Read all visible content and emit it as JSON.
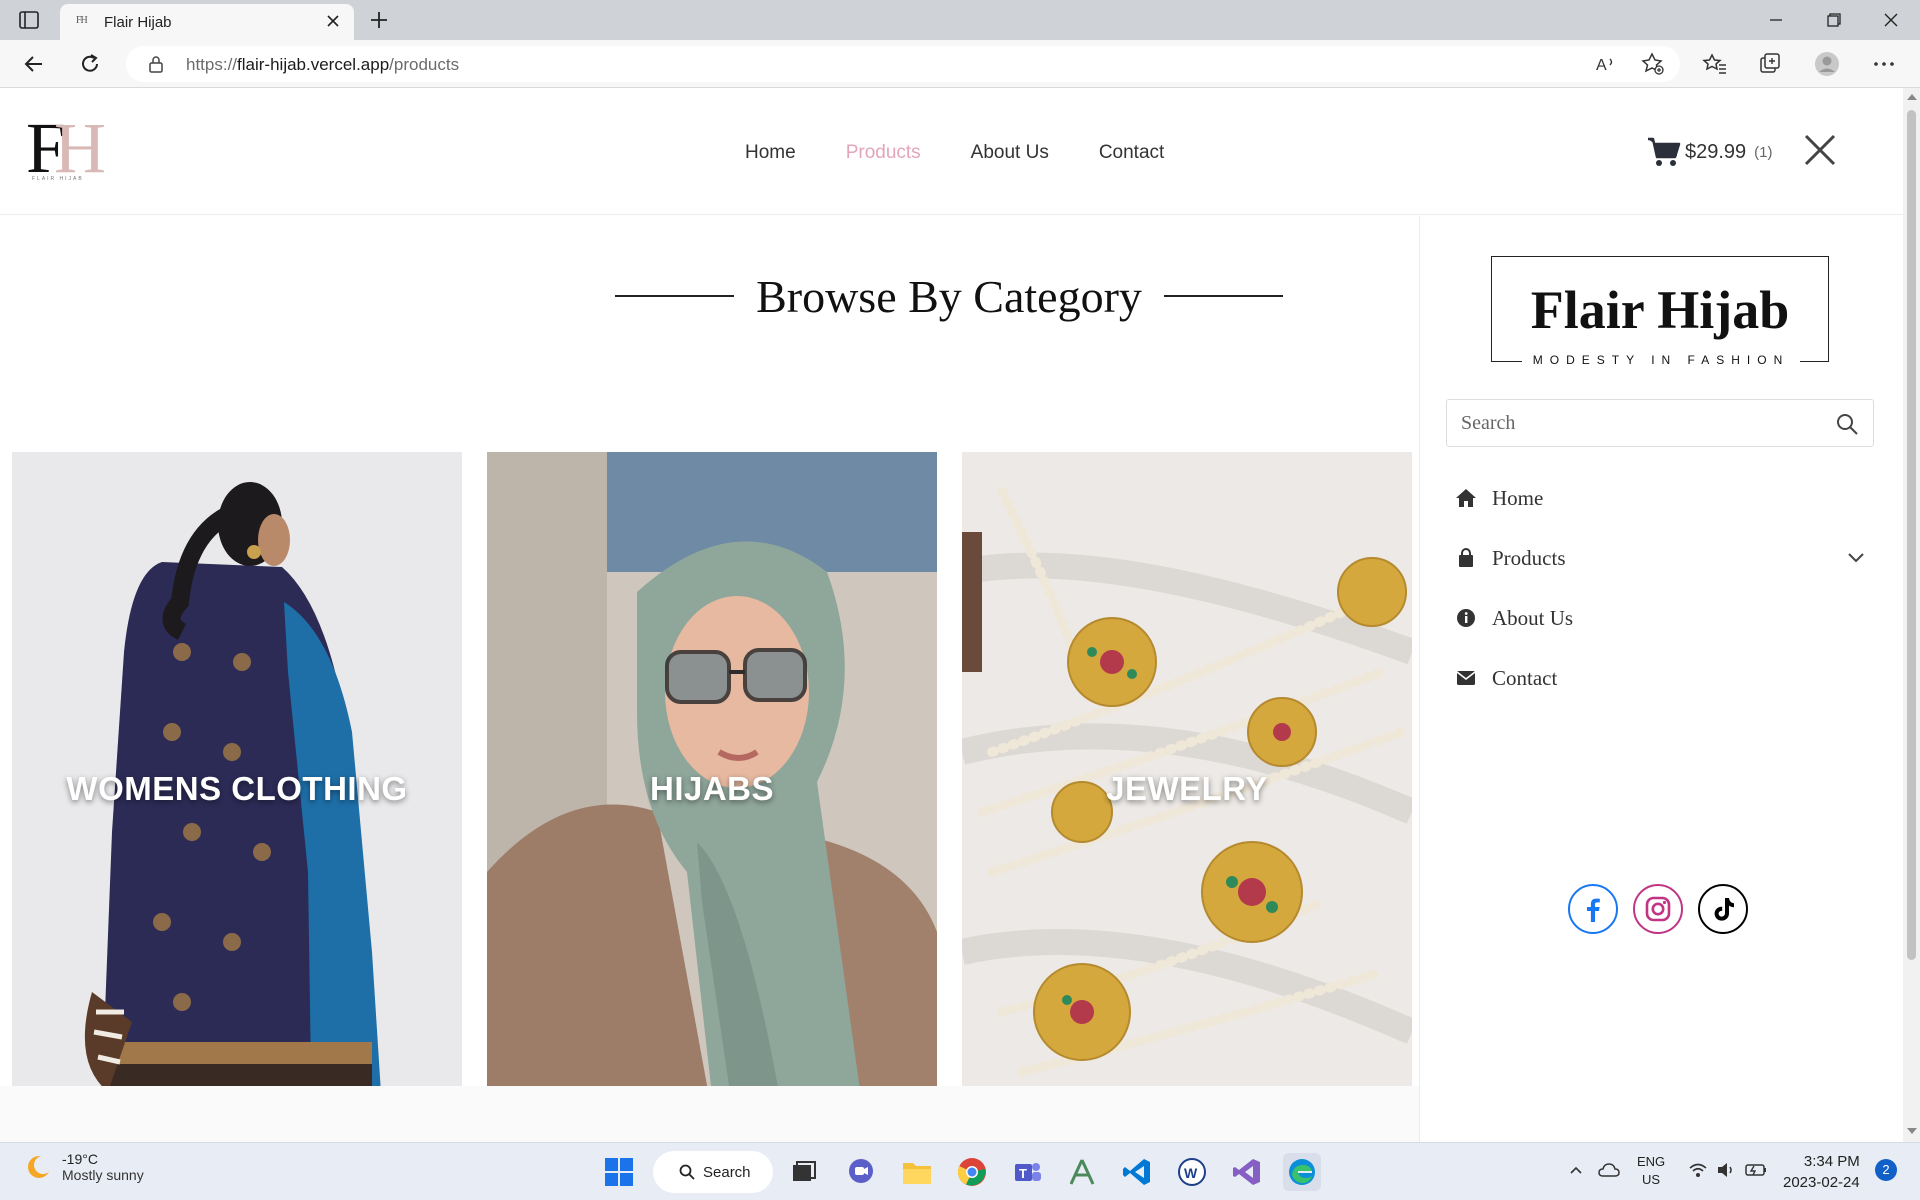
{
  "browser": {
    "tab_title": "Flair Hijab",
    "tab_favicon": "FH",
    "url_prefix": "https://",
    "url_domain": "flair-hijab.vercel.app",
    "url_path": "/products"
  },
  "site": {
    "logo_mark": "FH",
    "logo_sub": "FLAIR HIJAB",
    "nav": [
      "Home",
      "Products",
      "About Us",
      "Contact"
    ],
    "active_nav": "Products",
    "cart_total": "$29.99",
    "cart_count": "(1)"
  },
  "main": {
    "heading": "Browse By Category",
    "categories": [
      {
        "label": "WOMENS CLOTHING"
      },
      {
        "label": "HIJABS"
      },
      {
        "label": "JEWELRY"
      }
    ]
  },
  "drawer": {
    "brand_name": "Flair Hijab",
    "brand_tag": "MODESTY IN FASHION",
    "search_placeholder": "Search",
    "menu": [
      {
        "label": "Home",
        "icon": "home-icon"
      },
      {
        "label": "Products",
        "icon": "bag-icon"
      },
      {
        "label": "About Us",
        "icon": "info-icon"
      },
      {
        "label": "Contact",
        "icon": "mail-icon"
      }
    ],
    "socials": [
      {
        "name": "facebook-icon",
        "color": "#1877f2"
      },
      {
        "name": "instagram-icon",
        "color": "#c13584"
      },
      {
        "name": "tiktok-icon",
        "color": "#000000"
      }
    ]
  },
  "taskbar": {
    "weather_temp": "-19°C",
    "weather_desc": "Mostly sunny",
    "search_label": "Search",
    "lang_line1": "ENG",
    "lang_line2": "US",
    "time": "3:34 PM",
    "date": "2023-02-24",
    "notification_count": "2"
  },
  "colors": {
    "accent_pink": "#e3a6b9",
    "logo_pink": "#d9b9b6"
  }
}
